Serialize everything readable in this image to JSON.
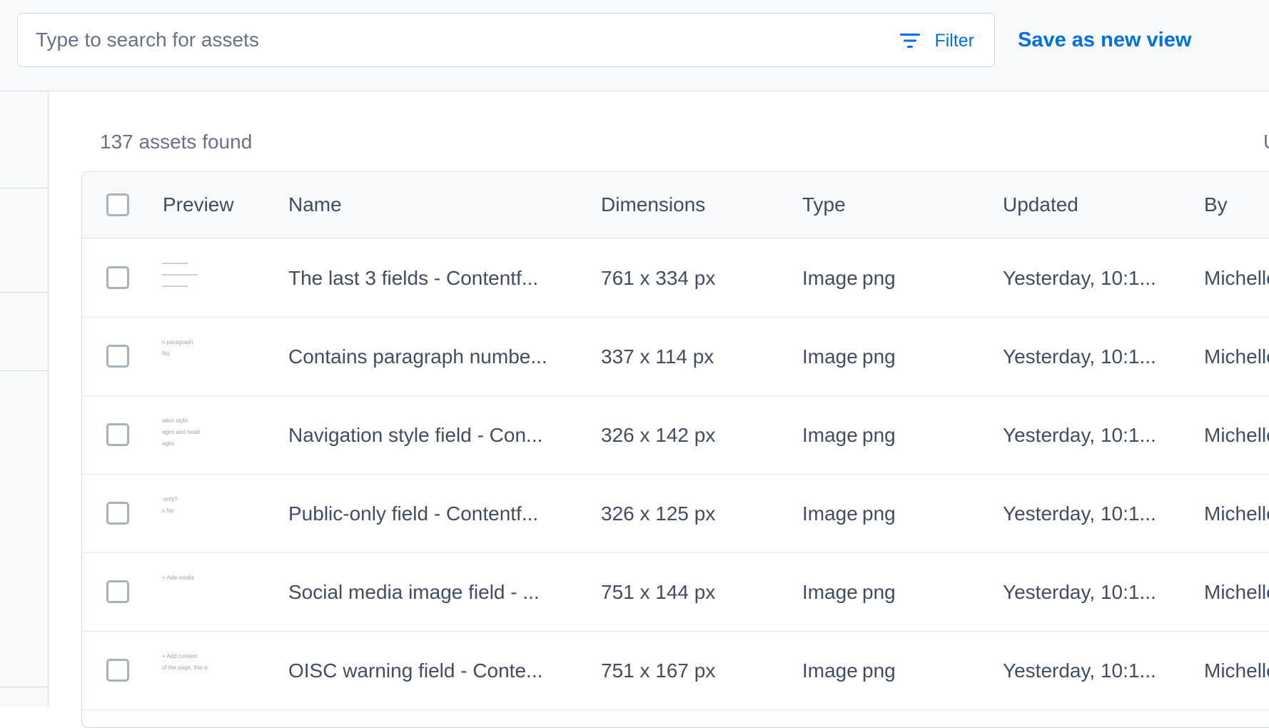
{
  "search": {
    "placeholder": "Type to search for assets",
    "filter_label": "Filter",
    "save_view_label": "Save as new view"
  },
  "results": {
    "count_text": "137 assets found",
    "right_cut_text": "U"
  },
  "table": {
    "headers": {
      "preview": "Preview",
      "name": "Name",
      "dimensions": "Dimensions",
      "type": "Type",
      "updated": "Updated",
      "by": "By"
    },
    "rows": [
      {
        "preview": {
          "icon": "form-preview",
          "lines": [
            "",
            "",
            ""
          ]
        },
        "name": "The last 3 fields - Contentf...",
        "dimensions": "761 x 334 px",
        "type": "Image",
        "format": "png",
        "updated": "Yesterday, 10:1...",
        "by": "Michelle"
      },
      {
        "preview": {
          "icon": "form-preview",
          "lines": [
            "n paragraph",
            "No"
          ]
        },
        "name": "Contains paragraph numbe...",
        "dimensions": "337 x 114 px",
        "type": "Image",
        "format": "png",
        "updated": "Yesterday, 10:1...",
        "by": "Michelle"
      },
      {
        "preview": {
          "icon": "form-preview",
          "lines": [
            "ation style",
            "ages and head",
            "ages"
          ]
        },
        "name": "Navigation style field - Con...",
        "dimensions": "326 x 142 px",
        "type": "Image",
        "format": "png",
        "updated": "Yesterday, 10:1...",
        "by": "Michelle"
      },
      {
        "preview": {
          "icon": "form-preview",
          "lines": [
            "-only?",
            "s  No"
          ]
        },
        "name": "Public-only field - Contentf...",
        "dimensions": "326 x 125 px",
        "type": "Image",
        "format": "png",
        "updated": "Yesterday, 10:1...",
        "by": "Michelle"
      },
      {
        "preview": {
          "icon": "form-preview",
          "lines": [
            "+ Add media"
          ]
        },
        "name": "Social media image field - ...",
        "dimensions": "751 x 144 px",
        "type": "Image",
        "format": "png",
        "updated": "Yesterday, 10:1...",
        "by": "Michelle"
      },
      {
        "preview": {
          "icon": "form-preview",
          "lines": [
            "+ Add content",
            "of the page, this is the"
          ]
        },
        "name": "OISC warning field - Conte...",
        "dimensions": "751 x 167 px",
        "type": "Image",
        "format": "png",
        "updated": "Yesterday, 10:1...",
        "by": "Michelle"
      }
    ]
  },
  "colors": {
    "accent": "#036fe3",
    "text": "#414d63",
    "muted": "#67728a",
    "border": "#d3dce0",
    "header_bg": "#f7f9fa"
  }
}
